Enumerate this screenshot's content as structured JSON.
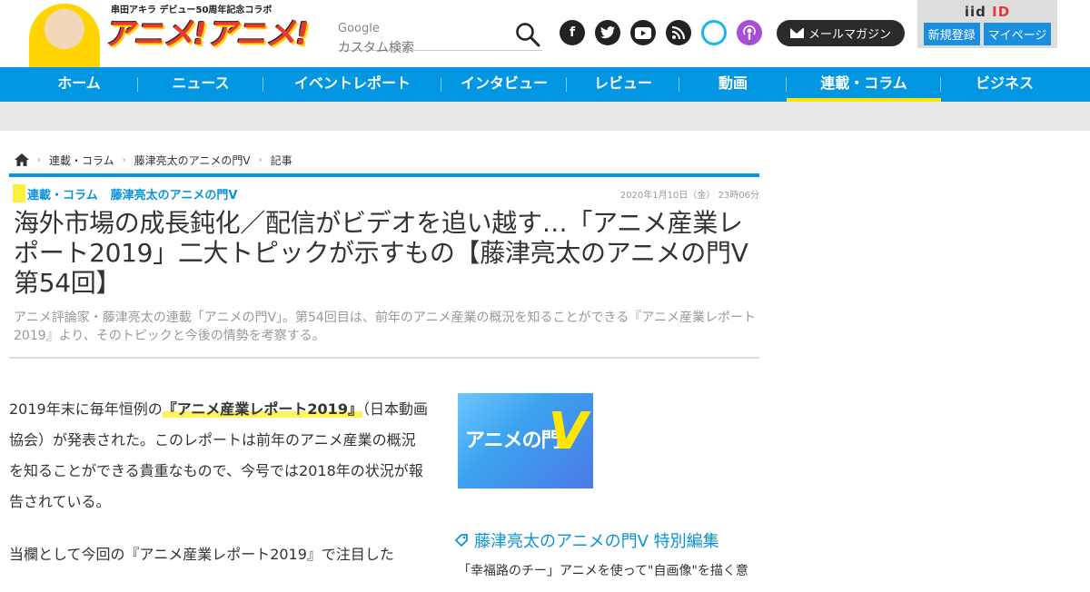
{
  "header": {
    "logo_top": "串田アキラ デビュー50周年記念コラボ",
    "logo_text": "アニメ!アニメ!",
    "search": {
      "brand": "Google",
      "placeholder": "カスタム検索"
    },
    "social": [
      "f",
      "t",
      "▶",
      "rss",
      "alexa",
      "podcast"
    ],
    "mail_label": "メールマガジン",
    "iid": {
      "logo_prefix": "iid",
      "logo_suffix": "ID",
      "register": "新規登録",
      "mypage": "マイページ"
    }
  },
  "nav": {
    "items": [
      {
        "label": "ホーム",
        "width": 130
      },
      {
        "label": "ニュース",
        "width": 138
      },
      {
        "label": "イベントレポート",
        "width": 196
      },
      {
        "label": "インタビュー",
        "width": 138
      },
      {
        "label": "レビュー",
        "width": 124
      },
      {
        "label": "動画",
        "width": 118
      },
      {
        "label": "連載・コラム",
        "width": 170
      },
      {
        "label": "ビジネス",
        "width": 140
      }
    ],
    "active": "連載・コラム"
  },
  "breadcrumb": [
    "連載・コラム",
    "藤津亮太のアニメの門V",
    "記事"
  ],
  "article": {
    "category": "連載・コラム",
    "series": "藤津亮太のアニメの門V",
    "date": "2020年1月10日（金） 23時06分",
    "title": "海外市場の成長鈍化／配信がビデオを追い越す…「アニメ産業レポート2019」二大トピックが示すもの【藤津亮太のアニメの門V 第54回】",
    "lead": "アニメ評論家・藤津亮太の連載「アニメの門V」。第54回目は、前年のアニメ産業の概況を知ることができる『アニメ産業レポート2019』より、そのトピックと今後の情勢を考察する。",
    "p1_pre": "2019年末に毎年恒例の",
    "p1_hl": "『アニメ産業レポート2019』",
    "p1_post": "（日本動画協会）が発表された。このレポートは前年のアニメ産業の概況を知ることができる貴重なもので、今号では2018年の状況が報告されている。",
    "p2": "当欄として今回の『アニメ産業レポート2019』で注目した"
  },
  "thumb": {
    "text": "アニメの門",
    "v": "V"
  },
  "special_link": "藤津亮太のアニメの門V 特別編集",
  "related": "「幸福路のチー」アニメを使って\"自画像\"を描く意"
}
